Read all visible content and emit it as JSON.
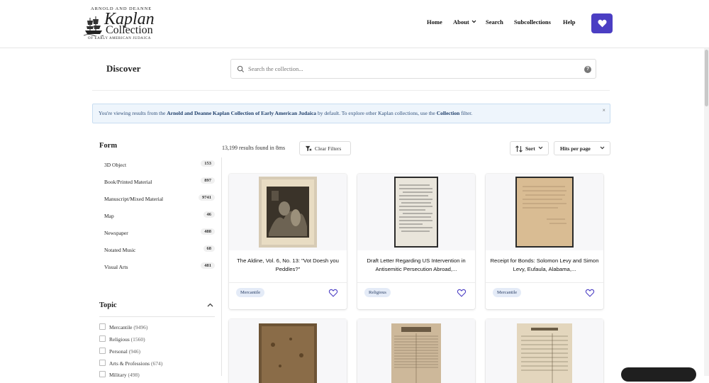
{
  "logo": {
    "line1": "ARNOLD AND DEANNE",
    "line2": "Kaplan",
    "line3": "Collection",
    "line4": "OF EARLY AMERICAN JUDAICA"
  },
  "nav": [
    {
      "label": "Home"
    },
    {
      "label": "About"
    },
    {
      "label": "Search"
    },
    {
      "label": "Subcollections"
    },
    {
      "label": "Help"
    }
  ],
  "page_title": "Discover",
  "search": {
    "placeholder": "Search the collection...",
    "help": "?"
  },
  "alert": {
    "pre": "You're viewing results from the ",
    "collection": "Arnold and Deanne Kaplan Collection of Early American Judaica",
    "mid": " by default. To explore other Kaplan collections, use the ",
    "filter": "Collection",
    "post": " filter.",
    "close": "×"
  },
  "form_facet": {
    "heading": "Form",
    "items": [
      {
        "label": "3D Object",
        "count": "153"
      },
      {
        "label": "Book/Printed Material",
        "count": "897"
      },
      {
        "label": "Manuscript/Mixed Material",
        "count": "9741"
      },
      {
        "label": "Map",
        "count": "46"
      },
      {
        "label": "Newspaper",
        "count": "488"
      },
      {
        "label": "Notated Music",
        "count": "68"
      },
      {
        "label": "Visual Arts",
        "count": "481"
      }
    ]
  },
  "topic_facet": {
    "heading": "Topic",
    "items": [
      {
        "label": "Mercantile",
        "count": "(9496)"
      },
      {
        "label": "Religious",
        "count": "(1560)"
      },
      {
        "label": "Personal",
        "count": "(946)"
      },
      {
        "label": "Arts & Professions",
        "count": "(674)"
      },
      {
        "label": "Military",
        "count": "(498)"
      }
    ]
  },
  "results_text": "13,199 results found in 8ms",
  "clear_filters": "Clear Filters",
  "sort_label": "Sort",
  "hits_label": "Hits per page",
  "cards": [
    {
      "title": "The Aldine, Vol. 6, No. 13: \"Vot Doesh you Peddles?\"",
      "tag": "Mercantile"
    },
    {
      "title": "Draft Letter Regarding US Intervention in Antisemitic Persecution Abroad,...",
      "tag": "Religious"
    },
    {
      "title": "Receipt for Bonds: Solomon Levy and Simon Levy, Eufaula, Alabama,...",
      "tag": "Mercantile"
    }
  ],
  "colors": {
    "accent": "#4b3ec3",
    "alert_bg": "#eef5fc",
    "tag_bg": "#e4ebf7"
  }
}
